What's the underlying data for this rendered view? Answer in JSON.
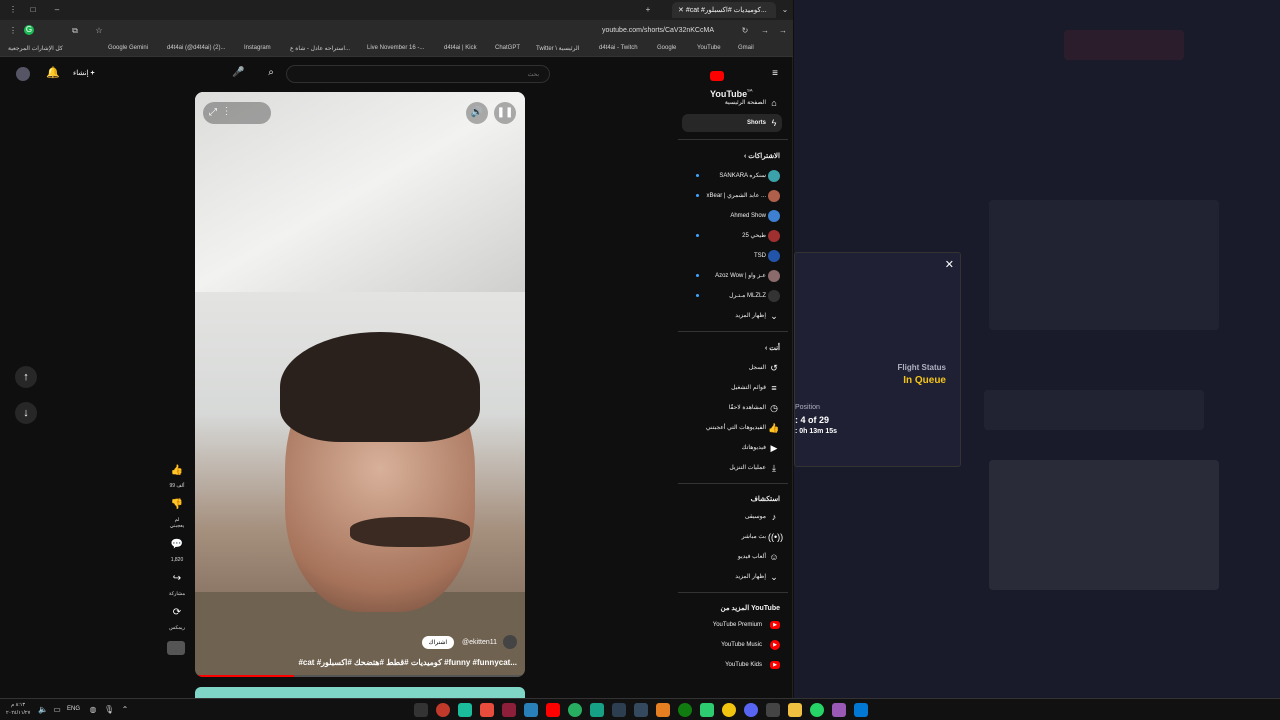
{
  "browser": {
    "tab_title": "#cat #كوميديات #اكسبلور...",
    "url": "youtube.com/shorts/CaV32nKCcMA",
    "bookmarks": [
      "كل الإشارات المرجعية",
      "Google Gemini",
      "d4t4ai (@d4t4ai) (2)...",
      "Instagram",
      "استراحه عادل - شاة ع...",
      "Live November 16 -...",
      "d4t4ai | Kick",
      "ChatGPT",
      "Twitter \\ الرئيسية",
      "d4t4ai - Twitch",
      "Google",
      "YouTube",
      "Gmail"
    ]
  },
  "youtube": {
    "logo": "YouTube",
    "country": "SA",
    "search_placeholder": "بحث",
    "create_label": "إنشاء",
    "sidebar": {
      "home": "الصفحة الرئيسية",
      "shorts": "Shorts",
      "subscriptions_header": "الاشتراكات",
      "subscriptions": [
        {
          "name": "SANKARA سنكره",
          "color": "#3aa2a8"
        },
        {
          "name": "xBear | عابد الشمري ...",
          "color": "#b0604a"
        },
        {
          "name": "Ahmed Show",
          "color": "#3d7fd1"
        },
        {
          "name": "طيحي 25",
          "color": "#a03030"
        },
        {
          "name": "TSD",
          "color": "#2255aa"
        },
        {
          "name": "Azoz Wow | عـز واو",
          "color": "#8a6a6a"
        },
        {
          "name": "مـتـرل MLZLZ",
          "color": "#333333"
        }
      ],
      "show_more_1": "إظهار المزيد",
      "you_header": "أنت",
      "you_items": [
        "السجل",
        "قوائم التشغيل",
        "المشاهدة لاحقًا",
        "الفيديوهات التي أعجبتني",
        "فيديوهاتك",
        "عمليات التنزيل"
      ],
      "explore_header": "استكشاف",
      "explore_items": [
        "موسيقى",
        "بث مباشر",
        "ألعاب فيديو"
      ],
      "show_more_2": "إظهار المزيد",
      "more_header": "المزيد من YouTube",
      "more_items": [
        "YouTube Premium",
        "YouTube Music",
        "YouTube Kids"
      ]
    },
    "short": {
      "handle": "@ekitten11",
      "subscribe": "اشتراك",
      "caption": "#cat #كوميديات #قطط #هتضحك #اكسبلور #funny #funnycat...",
      "likes": "99 ألف",
      "dislike": "لم يعجبني",
      "comments": "1,820",
      "share": "مشاركة",
      "remix": "ريمكس"
    }
  },
  "overlay": {
    "status_label": "Flight Status",
    "status_value": "In Queue",
    "position_label": "Position",
    "position_value": "4 of 29",
    "eta": "0h 13m 15s",
    "close": "✕"
  },
  "taskbar": {
    "lang": "ENG",
    "time": "٨:١٣ م",
    "date": "٢٠٢٤/١١/٢٧"
  }
}
